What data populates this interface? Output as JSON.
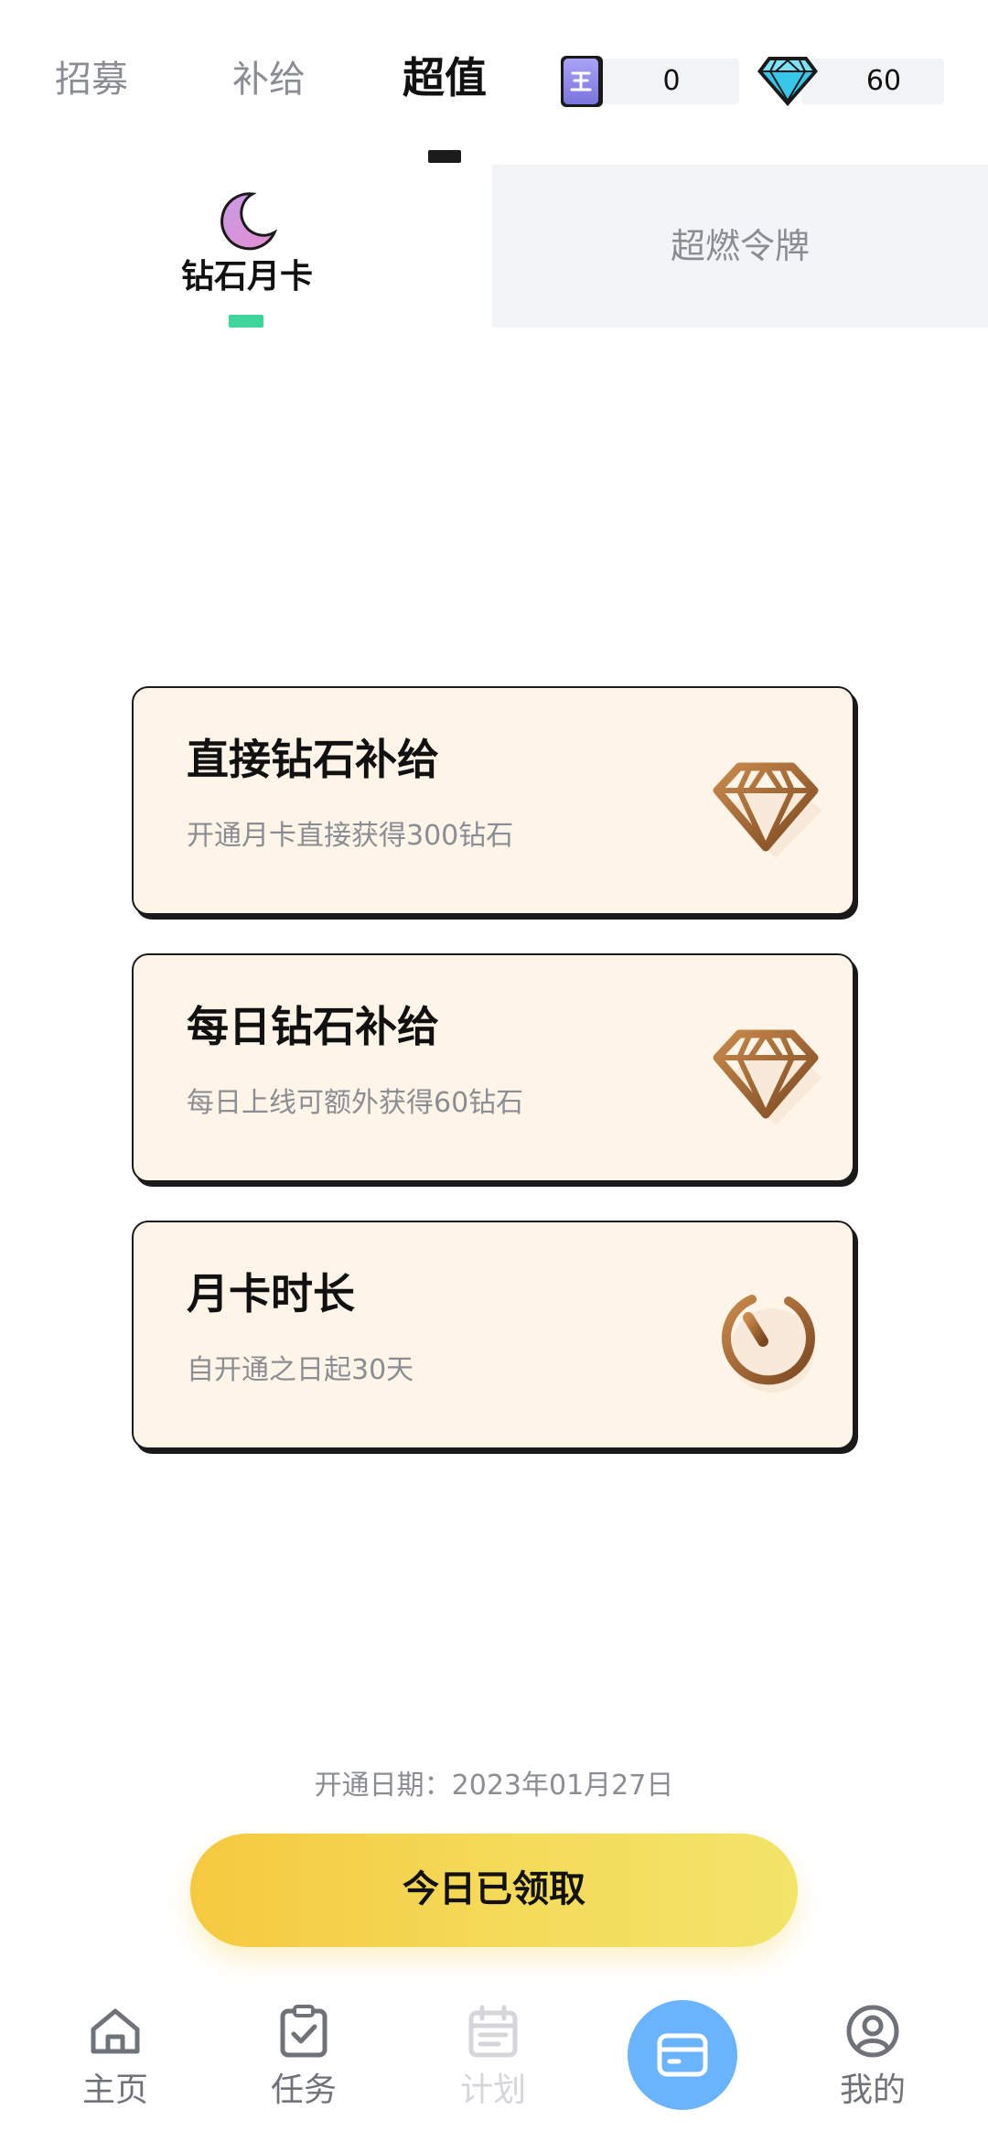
{
  "header": {
    "tabs": [
      {
        "label": "招募",
        "active": false
      },
      {
        "label": "补给",
        "active": false
      },
      {
        "label": "超值",
        "active": true
      }
    ],
    "currencies": {
      "token": {
        "value": "0",
        "icon": "token-card-icon"
      },
      "diamond": {
        "value": "60",
        "icon": "diamond-icon"
      }
    }
  },
  "sub_tabs": {
    "monthly": {
      "label": "钻石月卡",
      "icon": "moon-icon",
      "active": true
    },
    "token": {
      "label": "超燃令牌",
      "active": false
    }
  },
  "benefits": [
    {
      "title": "直接钻石补给",
      "desc": "开通月卡直接获得300钻石",
      "icon": "diamond-outline-icon"
    },
    {
      "title": "每日钻石补给",
      "desc": "每日上线可额外获得60钻石",
      "icon": "diamond-outline-icon"
    },
    {
      "title": "月卡时长",
      "desc": "自开通之日起30天",
      "icon": "timer-icon"
    }
  ],
  "activation": {
    "date_text": "开通日期：2023年01月27日",
    "claim_label": "今日已领取"
  },
  "bottom_nav": [
    {
      "label": "主页",
      "icon": "home-icon"
    },
    {
      "label": "任务",
      "icon": "task-clipboard-icon"
    },
    {
      "label": "计划",
      "icon": "calendar-icon",
      "disabled": true
    },
    {
      "label": "",
      "icon": "card-icon",
      "active": true
    },
    {
      "label": "我的",
      "icon": "profile-icon"
    }
  ],
  "colors": {
    "accent_green": "#3fd69c",
    "card_bg": "#fff4e8",
    "button_yellow": "#f5c93f",
    "nav_active_blue": "#6ab4ff",
    "bronze": "#a8672f"
  }
}
